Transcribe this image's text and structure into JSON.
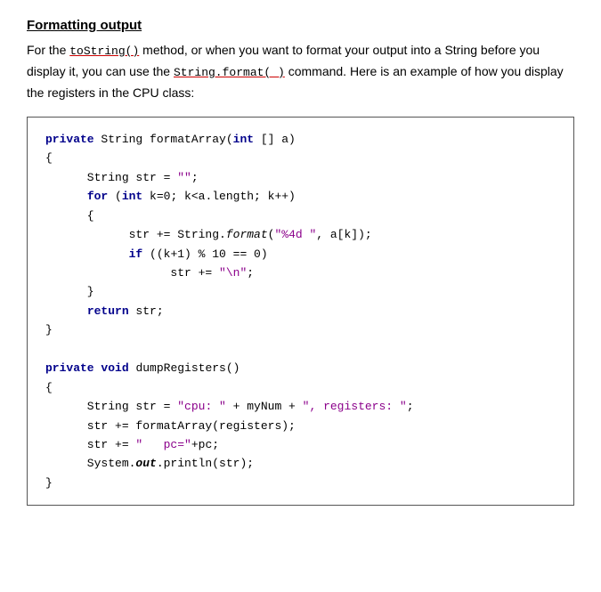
{
  "title": "Formatting output",
  "description": {
    "part1": "For the ",
    "method1": "toString()",
    "part2": " method, or when you want to format your output into a String before you display it, you can use the ",
    "method2": "String.format( )",
    "part3": " command.  Here is an example of how you display the registers in the CPU class:"
  },
  "code": {
    "block1": [
      "private String formatArray(int [] a)",
      "{",
      "      String str = \"\";",
      "      for (int k=0; k<a.length; k++)",
      "      {",
      "            str += String.format(\"%4d \", a[k]);",
      "            if ((k+1) % 10 == 0)",
      "                  str += \"\\n\";",
      "      }",
      "      return str;",
      "}"
    ],
    "block2": [
      "private void dumpRegisters()",
      "{",
      "      String str = \"cpu: \" + myNum + \", registers: \";",
      "      str += formatArray(registers);",
      "      str += \"   pc=\"+pc;",
      "      System.out.println(str);",
      "}"
    ]
  }
}
